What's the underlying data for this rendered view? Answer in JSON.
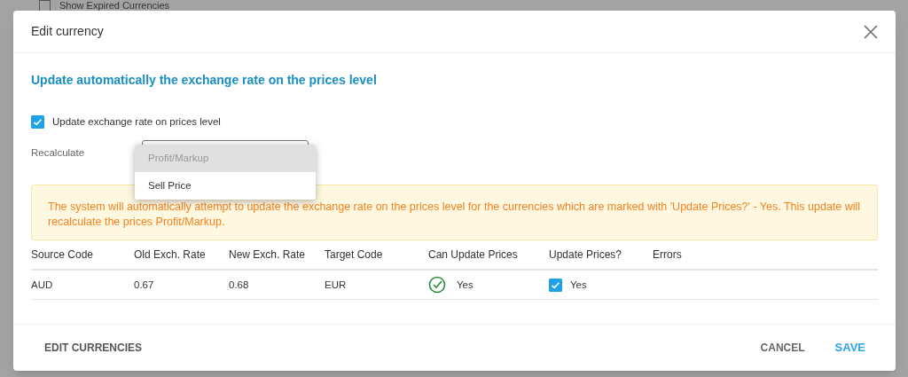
{
  "background": {
    "checkbox_label": "Show Expired Currencies",
    "checked": false
  },
  "dialog": {
    "title": "Edit currency",
    "heading": "Update automatically the exchange rate on the prices level",
    "update_checkbox": {
      "label": "Update exchange rate on prices level",
      "checked": true
    },
    "recalculate": {
      "label": "Recalculate",
      "options": [
        {
          "label": "Profit/Markup",
          "selected": true
        },
        {
          "label": "Sell Price",
          "selected": false
        }
      ]
    },
    "notice": "The system will automatically attempt to update the exchange rate on the prices level for the currencies which are marked with 'Update Prices?' - Yes. This update will recalculate the prices Profit/Markup.",
    "table": {
      "columns": [
        "Source Code",
        "Old Exch. Rate",
        "New Exch. Rate",
        "Target Code",
        "Can Update Prices",
        "Update Prices?",
        "Errors"
      ],
      "rows": [
        {
          "source": "AUD",
          "old_rate": "0.67",
          "new_rate": "0.68",
          "target": "EUR",
          "can_update": {
            "ok": true,
            "text": "Yes"
          },
          "update": {
            "checked": true,
            "text": "Yes"
          },
          "errors": ""
        }
      ]
    },
    "footer": {
      "left": "EDIT CURRENCIES",
      "cancel": "CANCEL",
      "save": "SAVE"
    }
  }
}
